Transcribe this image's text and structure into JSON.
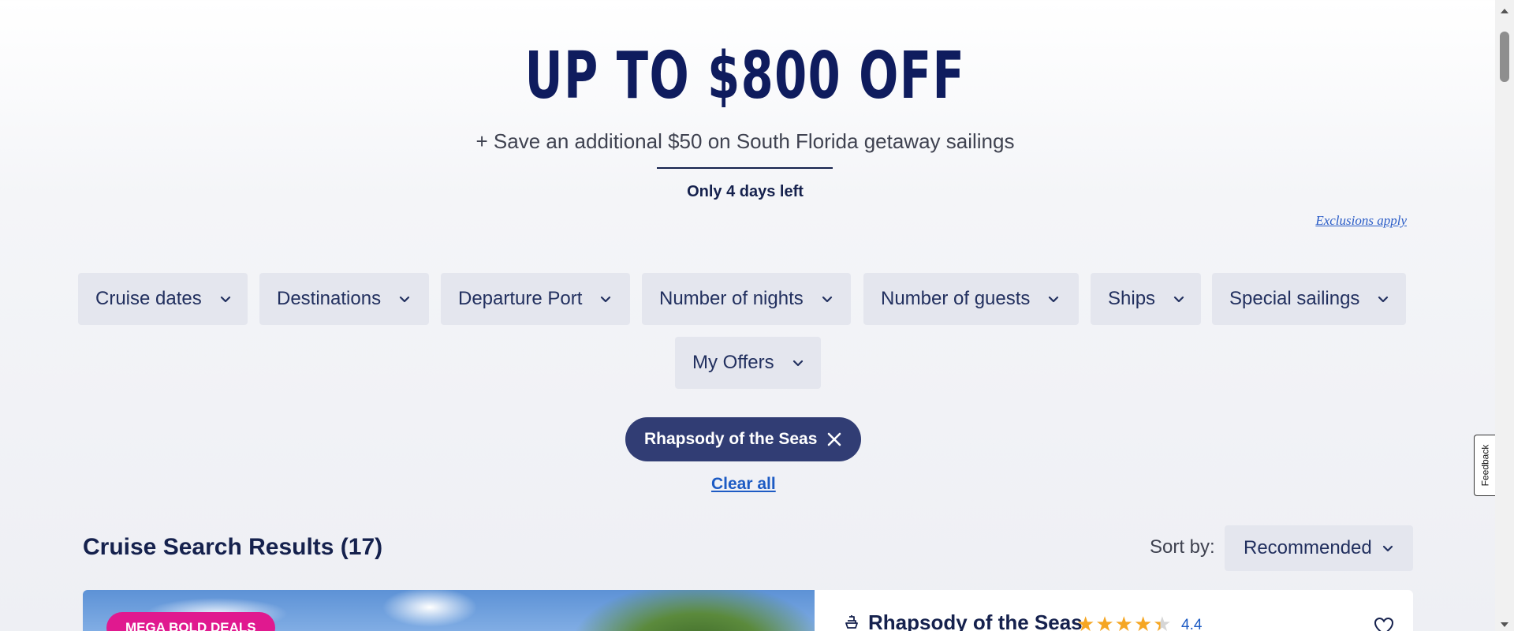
{
  "promo": {
    "title": "UP TO $800 OFF",
    "subtitle": "+ Save an additional $50 on South Florida getaway sailings",
    "countdown": "Only 4 days left",
    "exclusions_link": "Exclusions apply"
  },
  "filters": {
    "cruise_dates": "Cruise dates",
    "destinations": "Destinations",
    "departure_port": "Departure Port",
    "number_of_nights": "Number of nights",
    "number_of_guests": "Number of guests",
    "ships": "Ships",
    "special_sailings": "Special sailings",
    "my_offers": "My Offers"
  },
  "active_filters": {
    "chip_label": "Rhapsody of the Seas",
    "clear_all": "Clear all"
  },
  "results": {
    "title": "Cruise Search Results (17)",
    "sort_label": "Sort by:",
    "sort_value": "Recommended"
  },
  "card": {
    "badge": "MEGA BOLD DEALS",
    "ship_name": "Rhapsody of the Seas",
    "rating": "4.4",
    "rating_stars": 4.4
  },
  "feedback": "Feedback",
  "colors": {
    "navy": "#15214d",
    "chip": "#313d74",
    "filter_bg": "#e4e6ee",
    "link": "#1d5bc4",
    "badge": "#e0198f",
    "star": "#f5a623"
  }
}
